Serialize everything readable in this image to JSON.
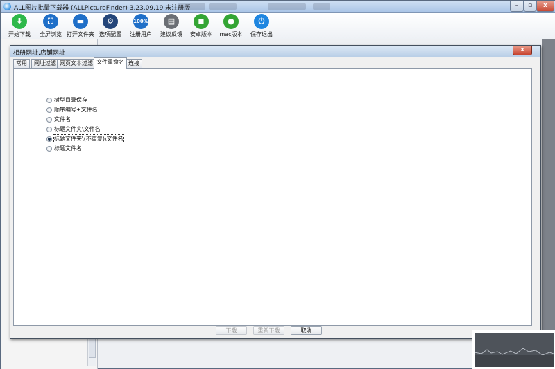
{
  "window": {
    "title": "ALL图片批量下载器 (ALLPictureFinder) 3.23.09.19 未注册版",
    "minimize_glyph": "–",
    "maximize_glyph": "▫",
    "close_glyph": "x"
  },
  "toolbar": {
    "buttons": [
      {
        "label": "开始下载",
        "icon": "download-icon",
        "color": "#2eb84a",
        "glyph": "⬇"
      },
      {
        "label": "全屏浏览",
        "icon": "fullscreen-icon",
        "color": "#1f6fc8",
        "glyph": "⛶"
      },
      {
        "label": "打开文件夹",
        "icon": "folder-icon",
        "color": "#1f6fc8",
        "glyph": "▬"
      },
      {
        "label": "选项配置",
        "icon": "gear-icon",
        "color": "#24467a",
        "glyph": "⚙"
      },
      {
        "label": "注册用户",
        "icon": "badge-100-icon",
        "color": "#1f6fc8",
        "glyph": "100%"
      },
      {
        "label": "建议反馈",
        "icon": "chat-icon",
        "color": "#6b6f75",
        "glyph": "▤"
      },
      {
        "label": "安卓版本",
        "icon": "android-icon",
        "color": "#34a534",
        "glyph": "◼"
      },
      {
        "label": "mac版本",
        "icon": "apple-icon",
        "color": "#34a534",
        "glyph": "●"
      },
      {
        "label": "保存退出",
        "icon": "power-icon",
        "color": "#1f86e0",
        "glyph": "⏻"
      }
    ]
  },
  "dialog": {
    "title": "相册网址,店铺网址",
    "close_glyph": "x",
    "tabs": [
      "常用",
      "网址过滤",
      "网页文本过滤",
      "文件重命名",
      "连接"
    ],
    "active_tab": 3,
    "options": [
      {
        "label": "树型目录保存",
        "checked": false
      },
      {
        "label": "顺序编号+文件名",
        "checked": false
      },
      {
        "label": "文件名",
        "checked": false
      },
      {
        "label": "标题文件夹\\文件名",
        "checked": false
      },
      {
        "label": "标题文件夹\\(不重复)\\文件名",
        "checked": true
      },
      {
        "label": "标题文件名",
        "checked": false
      }
    ],
    "buttons": {
      "download": "下载",
      "redownload": "重新下载",
      "cancel": "取消"
    }
  }
}
